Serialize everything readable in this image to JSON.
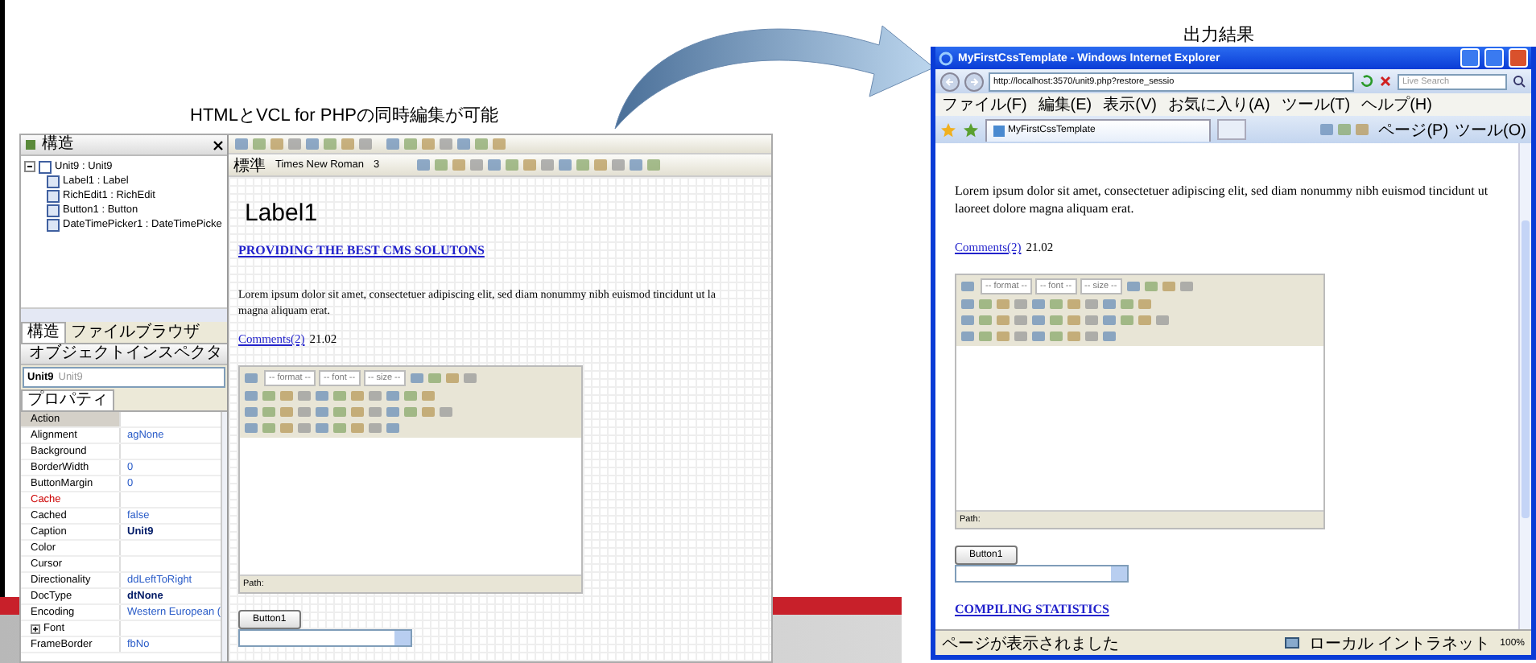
{
  "slide": {
    "caption": "HTMLとVCL for PHPの同時編集が可能",
    "output_label": "出力結果"
  },
  "ide": {
    "structure_panel": {
      "title": "構造",
      "tree": [
        {
          "label": "Unit9 : Unit9",
          "expanded": true,
          "children": [
            {
              "label": "Label1 : Label"
            },
            {
              "label": "RichEdit1 : RichEdit"
            },
            {
              "label": "Button1 : Button"
            },
            {
              "label": "DateTimePicker1 : DateTimePicke"
            }
          ]
        }
      ]
    },
    "panel_tabs": [
      {
        "label": "構造",
        "selected": true
      },
      {
        "label": "ファイルブラウザ",
        "selected": false
      }
    ],
    "inspector": {
      "title": "オブジェクトインスペクタ",
      "object": "Unit9",
      "object_type": "Unit9",
      "tabs": [
        {
          "label": "プロパティ",
          "selected": true
        }
      ],
      "properties": [
        {
          "name": "Action",
          "kind": "plain",
          "selected": true,
          "highlighted": false
        },
        {
          "name": "Alignment",
          "value": "agNone",
          "kind": "plain",
          "selected": false,
          "highlighted": false,
          "changed": false
        },
        {
          "name": "Background",
          "kind": "plain",
          "selected": false,
          "highlighted": false
        },
        {
          "name": "BorderWidth",
          "value": "0",
          "kind": "plain",
          "selected": false,
          "highlighted": false,
          "changed": false
        },
        {
          "name": "ButtonMargin",
          "value": "0",
          "kind": "plain",
          "selected": false,
          "highlighted": false,
          "changed": false
        },
        {
          "name": "Cache",
          "kind": "plain",
          "selected": false,
          "highlighted": true
        },
        {
          "name": "Cached",
          "value": "false",
          "kind": "plain",
          "selected": false,
          "highlighted": false,
          "changed": false
        },
        {
          "name": "Caption",
          "value": "Unit9",
          "kind": "plain",
          "selected": false,
          "highlighted": false,
          "changed": true
        },
        {
          "name": "Color",
          "kind": "plain",
          "selected": false,
          "highlighted": false
        },
        {
          "name": "Cursor",
          "kind": "plain",
          "selected": false,
          "highlighted": false
        },
        {
          "name": "Directionality",
          "value": "ddLeftToRight",
          "kind": "plain",
          "selected": false,
          "highlighted": false,
          "changed": false
        },
        {
          "name": "DocType",
          "value": "dtNone",
          "kind": "plain",
          "selected": false,
          "highlighted": false,
          "changed": true
        },
        {
          "name": "Encoding",
          "value": "Western European (",
          "kind": "plain",
          "selected": false,
          "highlighted": false,
          "changed": false
        },
        {
          "name": "Font",
          "kind": "group",
          "selected": false,
          "highlighted": false
        },
        {
          "name": "FrameBorder",
          "value": "fbNo",
          "kind": "plain",
          "selected": false,
          "highlighted": false,
          "changed": false
        }
      ]
    },
    "format_bar": {
      "block": "標準",
      "font": "Times New Roman",
      "size": "3"
    },
    "design": {
      "label": "Label1",
      "heading_link": "PROVIDING THE BEST CMS SOLUTONS",
      "paragraph_lines": [
        "Lorem ipsum dolor sit amet, consectetuer adipiscing elit, sed diam nonummy nibh euismod tincidunt ut la",
        "magna aliquam erat."
      ],
      "comments_link": "Comments(2)",
      "date": "21.02",
      "rich_edit": {
        "selects": [
          "-- format --",
          "-- font --",
          "-- size --"
        ],
        "status": "Path:"
      },
      "button": "Button1"
    }
  },
  "browser": {
    "title": "MyFirstCssTemplate - Windows Internet Explorer",
    "address": "http://localhost:3570/unit9.php?restore_sessio",
    "search_placeholder": "Live Search",
    "menu": [
      "ファイル(F)",
      "編集(E)",
      "表示(V)",
      "お気に入り(A)",
      "ツール(T)",
      "ヘルプ(H)"
    ],
    "tab": "MyFirstCssTemplate",
    "commands": [
      "ページ(P)",
      "ツール(O)"
    ],
    "page": {
      "paragraph": "Lorem ipsum dolor sit amet, consectetuer adipiscing elit, sed diam nonummy nibh euismod tincidunt ut laoreet dolore magna aliquam erat.",
      "comments_link": "Comments(2)",
      "date": "21.02",
      "rich_edit": {
        "selects": [
          "-- format --",
          "-- font --",
          "-- size --"
        ],
        "status": "Path:"
      },
      "button": "Button1",
      "footer_link": "COMPILING STATISTICS"
    },
    "status_bar": {
      "message": "ページが表示されました",
      "zone": "ローカル イントラネット",
      "zoom": "100%"
    }
  }
}
